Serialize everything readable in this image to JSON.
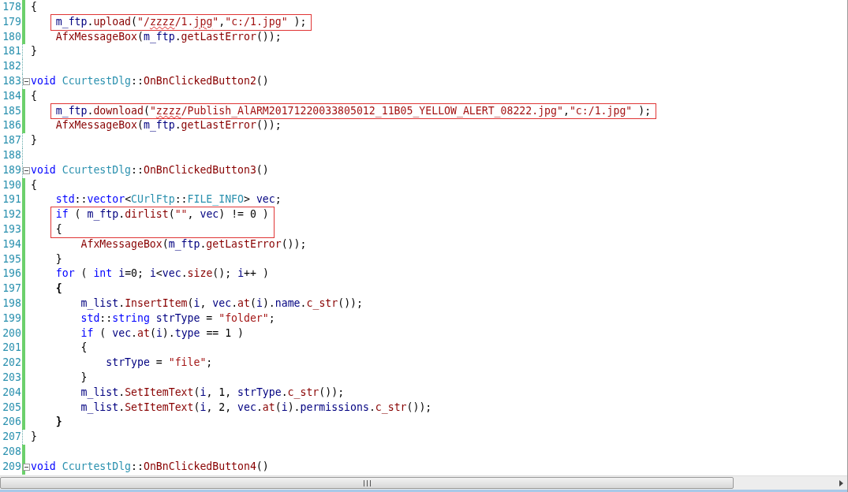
{
  "editor": {
    "lines": [
      {
        "number": "178",
        "changed": true,
        "fold": false,
        "boxed": false,
        "tokens": [
          {
            "kind": "punct",
            "text": "{"
          }
        ]
      },
      {
        "number": "179",
        "changed": true,
        "fold": false,
        "boxed": true,
        "tokens": [
          {
            "kind": "id",
            "text": "    m_ftp"
          },
          {
            "kind": "punct",
            "text": "."
          },
          {
            "kind": "fn",
            "text": "upload"
          },
          {
            "kind": "punct",
            "text": "("
          },
          {
            "kind": "str",
            "text": "\"/"
          },
          {
            "kind": "str_err",
            "text": "zzzz"
          },
          {
            "kind": "str",
            "text": "/1."
          },
          {
            "kind": "str_err",
            "text": "jpg"
          },
          {
            "kind": "str",
            "text": "\""
          },
          {
            "kind": "punct",
            "text": ","
          },
          {
            "kind": "str",
            "text": "\"c:/1.jpg\""
          },
          {
            "kind": "punct",
            "text": " );"
          }
        ]
      },
      {
        "number": "180",
        "changed": true,
        "fold": false,
        "boxed": false,
        "tokens": [
          {
            "kind": "fn",
            "text": "    AfxMessageBox"
          },
          {
            "kind": "punct",
            "text": "("
          },
          {
            "kind": "id",
            "text": "m_ftp"
          },
          {
            "kind": "punct",
            "text": "."
          },
          {
            "kind": "fn",
            "text": "getLastError"
          },
          {
            "kind": "punct",
            "text": "());"
          }
        ]
      },
      {
        "number": "181",
        "changed": false,
        "fold": false,
        "boxed": false,
        "tokens": [
          {
            "kind": "punct",
            "text": "}"
          }
        ]
      },
      {
        "number": "182",
        "changed": false,
        "fold": false,
        "boxed": false
      },
      {
        "number": "183",
        "changed": false,
        "fold": true,
        "boxed": false,
        "tokens": [
          {
            "kind": "kw",
            "text": "void "
          },
          {
            "kind": "type",
            "text": "CcurtestDlg"
          },
          {
            "kind": "punct",
            "text": "::"
          },
          {
            "kind": "fn",
            "text": "OnBnClickedButton2"
          },
          {
            "kind": "punct",
            "text": "()"
          }
        ]
      },
      {
        "number": "184",
        "changed": true,
        "fold": false,
        "boxed": false,
        "tokens": [
          {
            "kind": "punct",
            "text": "{"
          }
        ]
      },
      {
        "number": "185",
        "changed": true,
        "fold": false,
        "boxed": true,
        "tokens": [
          {
            "kind": "id",
            "text": "    m_ftp"
          },
          {
            "kind": "punct",
            "text": "."
          },
          {
            "kind": "fn",
            "text": "download"
          },
          {
            "kind": "punct",
            "text": "("
          },
          {
            "kind": "str",
            "text": "\""
          },
          {
            "kind": "str_err",
            "text": "zzzz"
          },
          {
            "kind": "str",
            "text": "/Publish_AlARM20171220033805012_11B05_YELLOW_ALERT_08222.jpg\""
          },
          {
            "kind": "punct",
            "text": ","
          },
          {
            "kind": "str",
            "text": "\"c:/1.jpg\""
          },
          {
            "kind": "punct",
            "text": " );"
          }
        ]
      },
      {
        "number": "186",
        "changed": true,
        "fold": false,
        "boxed": false,
        "tokens": [
          {
            "kind": "fn",
            "text": "    AfxMessageBox"
          },
          {
            "kind": "punct",
            "text": "("
          },
          {
            "kind": "id",
            "text": "m_ftp"
          },
          {
            "kind": "punct",
            "text": "."
          },
          {
            "kind": "fn",
            "text": "getLastError"
          },
          {
            "kind": "punct",
            "text": "());"
          }
        ]
      },
      {
        "number": "187",
        "changed": false,
        "fold": false,
        "boxed": false,
        "tokens": [
          {
            "kind": "punct",
            "text": "}"
          }
        ]
      },
      {
        "number": "188",
        "changed": false,
        "fold": false,
        "boxed": false
      },
      {
        "number": "189",
        "changed": false,
        "fold": true,
        "boxed": false,
        "tokens": [
          {
            "kind": "kw",
            "text": "void "
          },
          {
            "kind": "type",
            "text": "CcurtestDlg"
          },
          {
            "kind": "punct",
            "text": "::"
          },
          {
            "kind": "fn",
            "text": "OnBnClickedButton3"
          },
          {
            "kind": "punct",
            "text": "()"
          }
        ]
      },
      {
        "number": "190",
        "changed": true,
        "fold": false,
        "boxed": false,
        "tokens": [
          {
            "kind": "punct",
            "text": "{"
          }
        ]
      },
      {
        "number": "191",
        "changed": true,
        "fold": false,
        "boxed": false,
        "tokens": [
          {
            "kind": "kw",
            "text": "    std"
          },
          {
            "kind": "punct",
            "text": "::"
          },
          {
            "kind": "kw",
            "text": "vector"
          },
          {
            "kind": "punct",
            "text": "<"
          },
          {
            "kind": "type",
            "text": "CUrlFtp"
          },
          {
            "kind": "punct",
            "text": "::"
          },
          {
            "kind": "type",
            "text": "FILE_INFO"
          },
          {
            "kind": "punct",
            "text": "> "
          },
          {
            "kind": "id",
            "text": "vec"
          },
          {
            "kind": "punct",
            "text": ";"
          }
        ]
      },
      {
        "number": "192",
        "changed": true,
        "fold": false,
        "boxed": true,
        "tokens": [
          {
            "kind": "kw",
            "text": "    if"
          },
          {
            "kind": "punct",
            "text": " ( "
          },
          {
            "kind": "id",
            "text": "m_ftp"
          },
          {
            "kind": "punct",
            "text": "."
          },
          {
            "kind": "fn",
            "text": "dirlist"
          },
          {
            "kind": "punct",
            "text": "("
          },
          {
            "kind": "str",
            "text": "\"\""
          },
          {
            "kind": "punct",
            "text": ", "
          },
          {
            "kind": "id",
            "text": "vec"
          },
          {
            "kind": "punct",
            "text": ") != 0 )"
          }
        ]
      },
      {
        "number": "193",
        "changed": true,
        "fold": false,
        "boxed": true,
        "tokens": [
          {
            "kind": "punct",
            "text": "    {"
          }
        ]
      },
      {
        "number": "194",
        "changed": true,
        "fold": false,
        "boxed": false,
        "tokens": [
          {
            "kind": "fn",
            "text": "        AfxMessageBox"
          },
          {
            "kind": "punct",
            "text": "("
          },
          {
            "kind": "id",
            "text": "m_ftp"
          },
          {
            "kind": "punct",
            "text": "."
          },
          {
            "kind": "fn",
            "text": "getLastError"
          },
          {
            "kind": "punct",
            "text": "());"
          }
        ]
      },
      {
        "number": "195",
        "changed": true,
        "fold": false,
        "boxed": false,
        "tokens": [
          {
            "kind": "punct",
            "text": "    }"
          }
        ]
      },
      {
        "number": "196",
        "changed": true,
        "fold": false,
        "boxed": false,
        "tokens": [
          {
            "kind": "kw",
            "text": "    for"
          },
          {
            "kind": "punct",
            "text": " ( "
          },
          {
            "kind": "kw",
            "text": "int "
          },
          {
            "kind": "id",
            "text": "i"
          },
          {
            "kind": "punct",
            "text": "=0; "
          },
          {
            "kind": "id",
            "text": "i"
          },
          {
            "kind": "punct",
            "text": "<"
          },
          {
            "kind": "id",
            "text": "vec"
          },
          {
            "kind": "punct",
            "text": "."
          },
          {
            "kind": "fn",
            "text": "size"
          },
          {
            "kind": "punct",
            "text": "(); "
          },
          {
            "kind": "id",
            "text": "i"
          },
          {
            "kind": "punct",
            "text": "++ )"
          }
        ]
      },
      {
        "number": "197",
        "changed": true,
        "fold": false,
        "boxed": false,
        "tokens": [
          {
            "kind": "brace_match",
            "text": "    {"
          }
        ]
      },
      {
        "number": "198",
        "changed": true,
        "fold": false,
        "boxed": false,
        "tokens": [
          {
            "kind": "id",
            "text": "        m_list"
          },
          {
            "kind": "punct",
            "text": "."
          },
          {
            "kind": "fn",
            "text": "InsertItem"
          },
          {
            "kind": "punct",
            "text": "("
          },
          {
            "kind": "id",
            "text": "i"
          },
          {
            "kind": "punct",
            "text": ", "
          },
          {
            "kind": "id",
            "text": "vec"
          },
          {
            "kind": "punct",
            "text": "."
          },
          {
            "kind": "fn",
            "text": "at"
          },
          {
            "kind": "punct",
            "text": "("
          },
          {
            "kind": "id",
            "text": "i"
          },
          {
            "kind": "punct",
            "text": ")."
          },
          {
            "kind": "id",
            "text": "name"
          },
          {
            "kind": "punct",
            "text": "."
          },
          {
            "kind": "fn",
            "text": "c_str"
          },
          {
            "kind": "punct",
            "text": "());"
          }
        ]
      },
      {
        "number": "199",
        "changed": true,
        "fold": false,
        "boxed": false,
        "tokens": [
          {
            "kind": "kw",
            "text": "        std"
          },
          {
            "kind": "punct",
            "text": "::"
          },
          {
            "kind": "kw",
            "text": "string "
          },
          {
            "kind": "id",
            "text": "strType"
          },
          {
            "kind": "punct",
            "text": " = "
          },
          {
            "kind": "str",
            "text": "\"folder\""
          },
          {
            "kind": "punct",
            "text": ";"
          }
        ]
      },
      {
        "number": "200",
        "changed": true,
        "fold": false,
        "boxed": false,
        "tokens": [
          {
            "kind": "kw",
            "text": "        if"
          },
          {
            "kind": "punct",
            "text": " ( "
          },
          {
            "kind": "id",
            "text": "vec"
          },
          {
            "kind": "punct",
            "text": "."
          },
          {
            "kind": "fn",
            "text": "at"
          },
          {
            "kind": "punct",
            "text": "("
          },
          {
            "kind": "id",
            "text": "i"
          },
          {
            "kind": "punct",
            "text": ")."
          },
          {
            "kind": "id",
            "text": "type"
          },
          {
            "kind": "punct",
            "text": " == 1 )"
          }
        ]
      },
      {
        "number": "201",
        "changed": true,
        "fold": false,
        "boxed": false,
        "tokens": [
          {
            "kind": "punct",
            "text": "        {"
          }
        ]
      },
      {
        "number": "202",
        "changed": true,
        "fold": false,
        "boxed": false,
        "tokens": [
          {
            "kind": "id",
            "text": "            strType"
          },
          {
            "kind": "punct",
            "text": " = "
          },
          {
            "kind": "str",
            "text": "\"file\""
          },
          {
            "kind": "punct",
            "text": ";"
          }
        ]
      },
      {
        "number": "203",
        "changed": true,
        "fold": false,
        "boxed": false,
        "tokens": [
          {
            "kind": "punct",
            "text": "        }"
          }
        ]
      },
      {
        "number": "204",
        "changed": true,
        "fold": false,
        "boxed": false,
        "tokens": [
          {
            "kind": "id",
            "text": "        m_list"
          },
          {
            "kind": "punct",
            "text": "."
          },
          {
            "kind": "fn",
            "text": "SetItemText"
          },
          {
            "kind": "punct",
            "text": "("
          },
          {
            "kind": "id",
            "text": "i"
          },
          {
            "kind": "punct",
            "text": ", 1, "
          },
          {
            "kind": "id",
            "text": "strType"
          },
          {
            "kind": "punct",
            "text": "."
          },
          {
            "kind": "fn",
            "text": "c_str"
          },
          {
            "kind": "punct",
            "text": "());"
          }
        ]
      },
      {
        "number": "205",
        "changed": true,
        "fold": false,
        "boxed": false,
        "tokens": [
          {
            "kind": "id",
            "text": "        m_list"
          },
          {
            "kind": "punct",
            "text": "."
          },
          {
            "kind": "fn",
            "text": "SetItemText"
          },
          {
            "kind": "punct",
            "text": "("
          },
          {
            "kind": "id",
            "text": "i"
          },
          {
            "kind": "punct",
            "text": ", 2, "
          },
          {
            "kind": "id",
            "text": "vec"
          },
          {
            "kind": "punct",
            "text": "."
          },
          {
            "kind": "fn",
            "text": "at"
          },
          {
            "kind": "punct",
            "text": "("
          },
          {
            "kind": "id",
            "text": "i"
          },
          {
            "kind": "punct",
            "text": ")."
          },
          {
            "kind": "id",
            "text": "permissions"
          },
          {
            "kind": "punct",
            "text": "."
          },
          {
            "kind": "fn",
            "text": "c_str"
          },
          {
            "kind": "punct",
            "text": "());"
          }
        ]
      },
      {
        "number": "206",
        "changed": true,
        "fold": false,
        "boxed": false,
        "tokens": [
          {
            "kind": "brace_match",
            "text": "    }"
          }
        ]
      },
      {
        "number": "207",
        "changed": false,
        "fold": false,
        "boxed": false,
        "tokens": [
          {
            "kind": "punct",
            "text": "}"
          }
        ]
      },
      {
        "number": "208",
        "changed": true,
        "fold": false,
        "boxed": false
      },
      {
        "number": "209",
        "changed": true,
        "fold": true,
        "boxed": false,
        "tokens": [
          {
            "kind": "kw",
            "text": "void "
          },
          {
            "kind": "type",
            "text": "CcurtestDlg"
          },
          {
            "kind": "punct",
            "text": "::"
          },
          {
            "kind": "fn",
            "text": "OnBnClickedButton4"
          },
          {
            "kind": "punct",
            "text": "()"
          }
        ]
      }
    ]
  }
}
